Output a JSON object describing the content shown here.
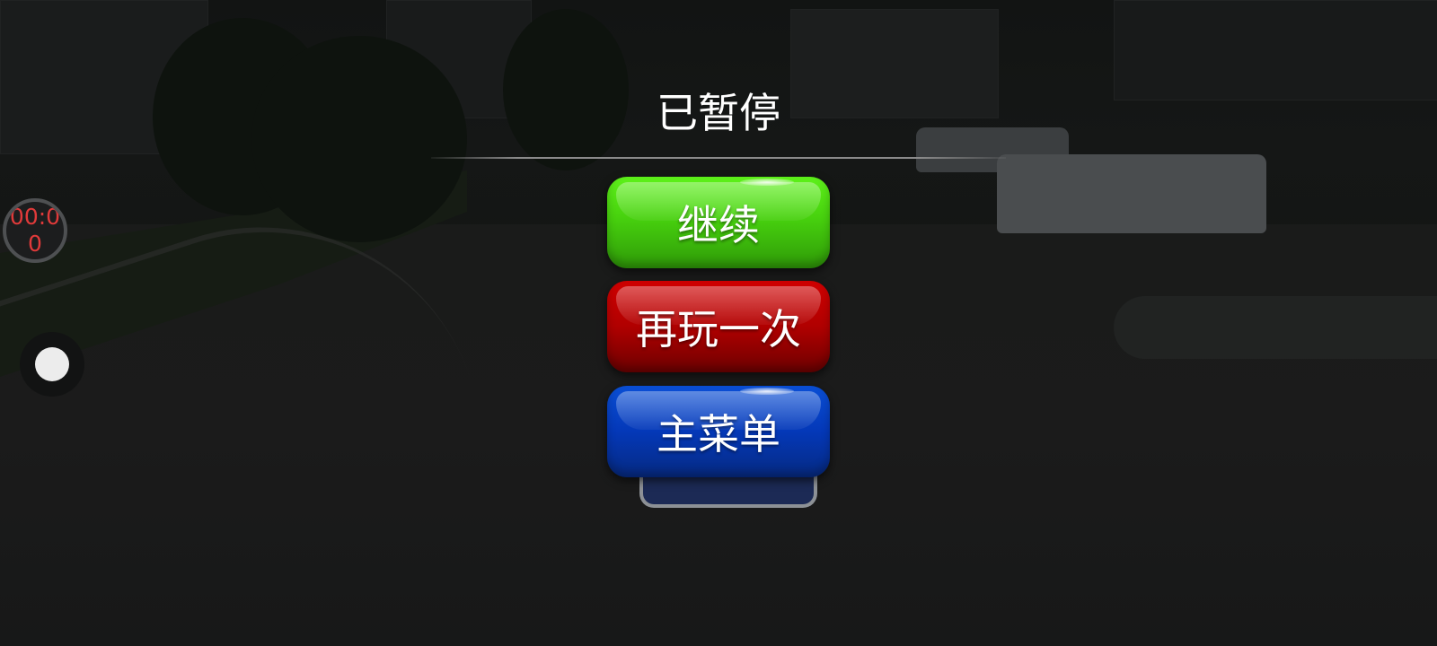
{
  "pause_menu": {
    "title": "已暂停",
    "buttons": [
      {
        "label": "继续",
        "color": "#47d10e"
      },
      {
        "label": "再玩一次",
        "color": "#b00000"
      },
      {
        "label": "主菜单",
        "color": "#0438b8"
      }
    ]
  },
  "hud": {
    "timer_line1": "00:0",
    "timer_line2": "0",
    "timer_color": "#e03a3a"
  }
}
